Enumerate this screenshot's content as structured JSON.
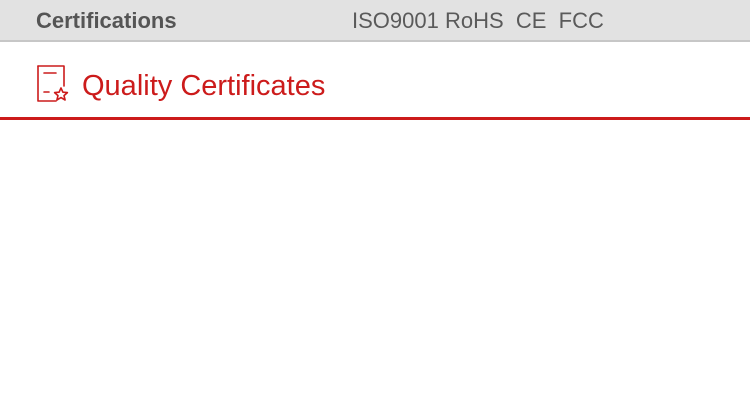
{
  "certifications_bar": {
    "label": "Certifications",
    "values": "ISO9001 RoHS  CE  FCC"
  },
  "section": {
    "title": "Quality Certificates",
    "icon": "certificate-icon"
  },
  "colors": {
    "accent": "#cc1b1b",
    "bar_background": "#e2e2e2",
    "bar_text": "#555555"
  }
}
